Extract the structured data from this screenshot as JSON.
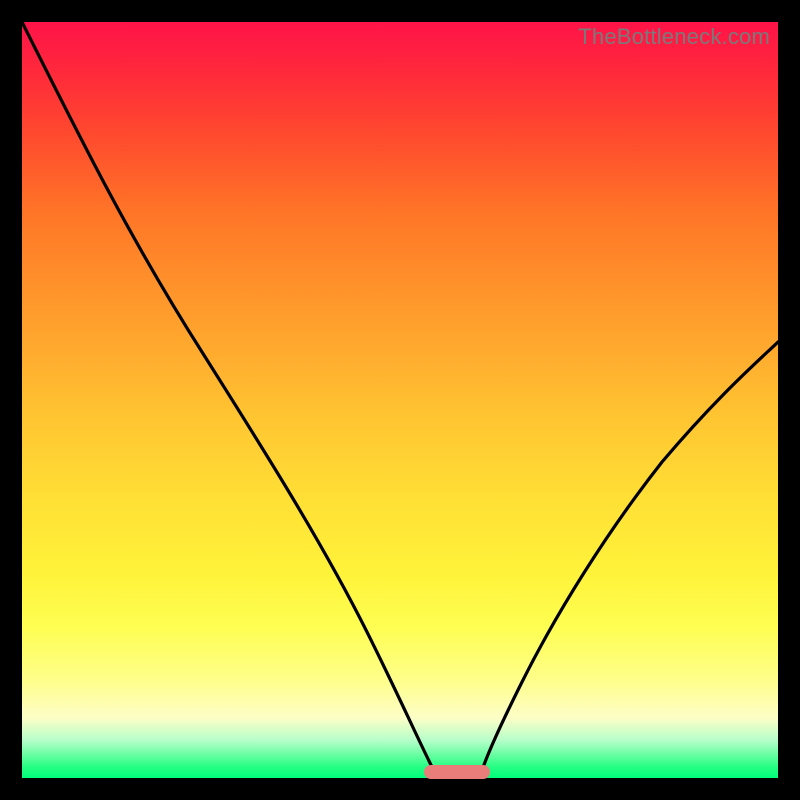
{
  "watermark": "TheBottleneck.com",
  "colors": {
    "frame": "#000000",
    "curve": "#000000",
    "marker": "#e87d7a",
    "gradient_stops": [
      "#ff1349",
      "#ff2a3a",
      "#ff4a2e",
      "#ff7427",
      "#ff8f2a",
      "#ffa92e",
      "#ffc431",
      "#ffdf35",
      "#fff33a",
      "#fefe52",
      "#fefe8a",
      "#fdfec6",
      "#b7feca",
      "#66fea0",
      "#27fe84",
      "#00fe7a"
    ]
  },
  "chart_data": {
    "type": "line",
    "title": "",
    "xlabel": "",
    "ylabel": "",
    "xlim": [
      0,
      100
    ],
    "ylim": [
      0,
      100
    ],
    "series": [
      {
        "name": "left-curve",
        "x": [
          0,
          3,
          7,
          12,
          18,
          24,
          30,
          36,
          41,
          45,
          48,
          50.5,
          52.5,
          54,
          54.8
        ],
        "values": [
          100,
          93,
          85,
          77,
          68,
          59,
          50,
          41,
          32,
          23,
          15,
          8,
          3,
          0.6,
          0
        ]
      },
      {
        "name": "right-curve",
        "x": [
          60.5,
          62,
          64,
          67,
          71,
          76,
          82,
          88,
          94,
          100
        ],
        "values": [
          0,
          1.5,
          5,
          11,
          19,
          28,
          37,
          45,
          52,
          58
        ]
      }
    ],
    "marker": {
      "x_start": 53,
      "x_end": 62,
      "y": 0
    }
  }
}
